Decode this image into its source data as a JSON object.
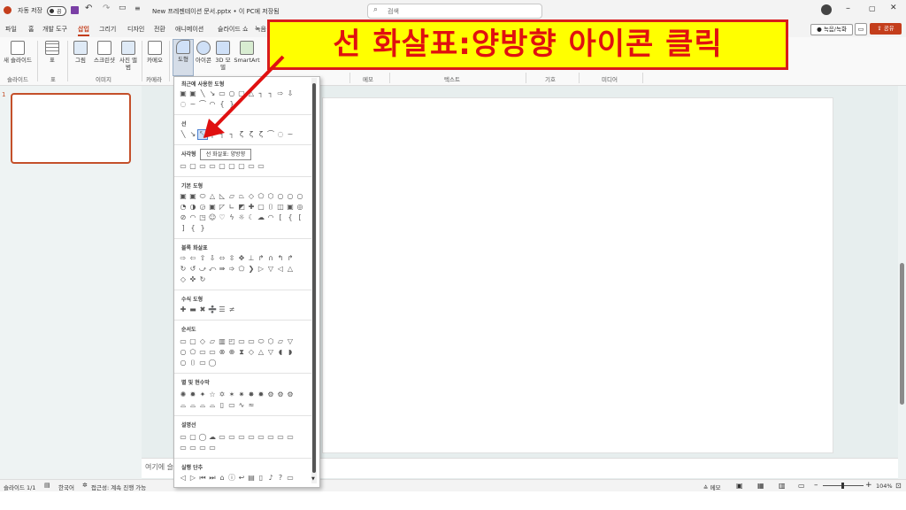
{
  "titlebar": {
    "autosave_label": "자동 저장",
    "autosave_state": "끔",
    "document_title": "New 프레젠테이션 문서.pptx • 이 PC에 저장됨",
    "search_placeholder": "검색",
    "record_button": "녹음/녹화",
    "share_button": "공유"
  },
  "tabs": [
    "파일",
    "홈",
    "개발 도구",
    "삽입",
    "그리기",
    "디자인",
    "전환",
    "애니메이션",
    "슬라이드 쇼",
    "녹음"
  ],
  "active_tab": "삽입",
  "ribbon": {
    "new_slide": "새 슬라이드",
    "table": "표",
    "picture": "그림",
    "screenshot": "스크린샷",
    "photo_album": "사진 앨범",
    "camera": "카메오",
    "shapes": "도형",
    "icons": "아이콘",
    "model3d": "3D 모델",
    "smartart": "SmartArt",
    "groups": {
      "slides": "슬라이드",
      "tables": "표",
      "images": "이미지",
      "camera": "카메라",
      "memo": "메모",
      "text": "텍스트",
      "symbols": "기호",
      "media": "미디어"
    }
  },
  "slide_panel": {
    "thumb_number": "1"
  },
  "notes_placeholder": "여기에 슬",
  "status": {
    "slide_counter": "슬라이드 1/1",
    "language": "한국어",
    "accessibility": "접근성: 계속 진행 가능",
    "notes_button": "메모",
    "zoom": "104%"
  },
  "shapes_menu": {
    "sections": [
      "최근에 사용한 도형",
      "선",
      "사각형",
      "기본 도형",
      "블록 화살표",
      "수식 도형",
      "순서도",
      "별 및 현수막",
      "설명선",
      "실행 단추"
    ],
    "tooltip": "선 화살표: 양방향"
  },
  "callout": {
    "text": "선 화살표:양방향 아이콘 클릭",
    "border_color": "#d81b1b",
    "fill_color": "#ffff00"
  },
  "colors": {
    "accent": "#c43e1c",
    "share_button_bg": "#c43e1c"
  }
}
